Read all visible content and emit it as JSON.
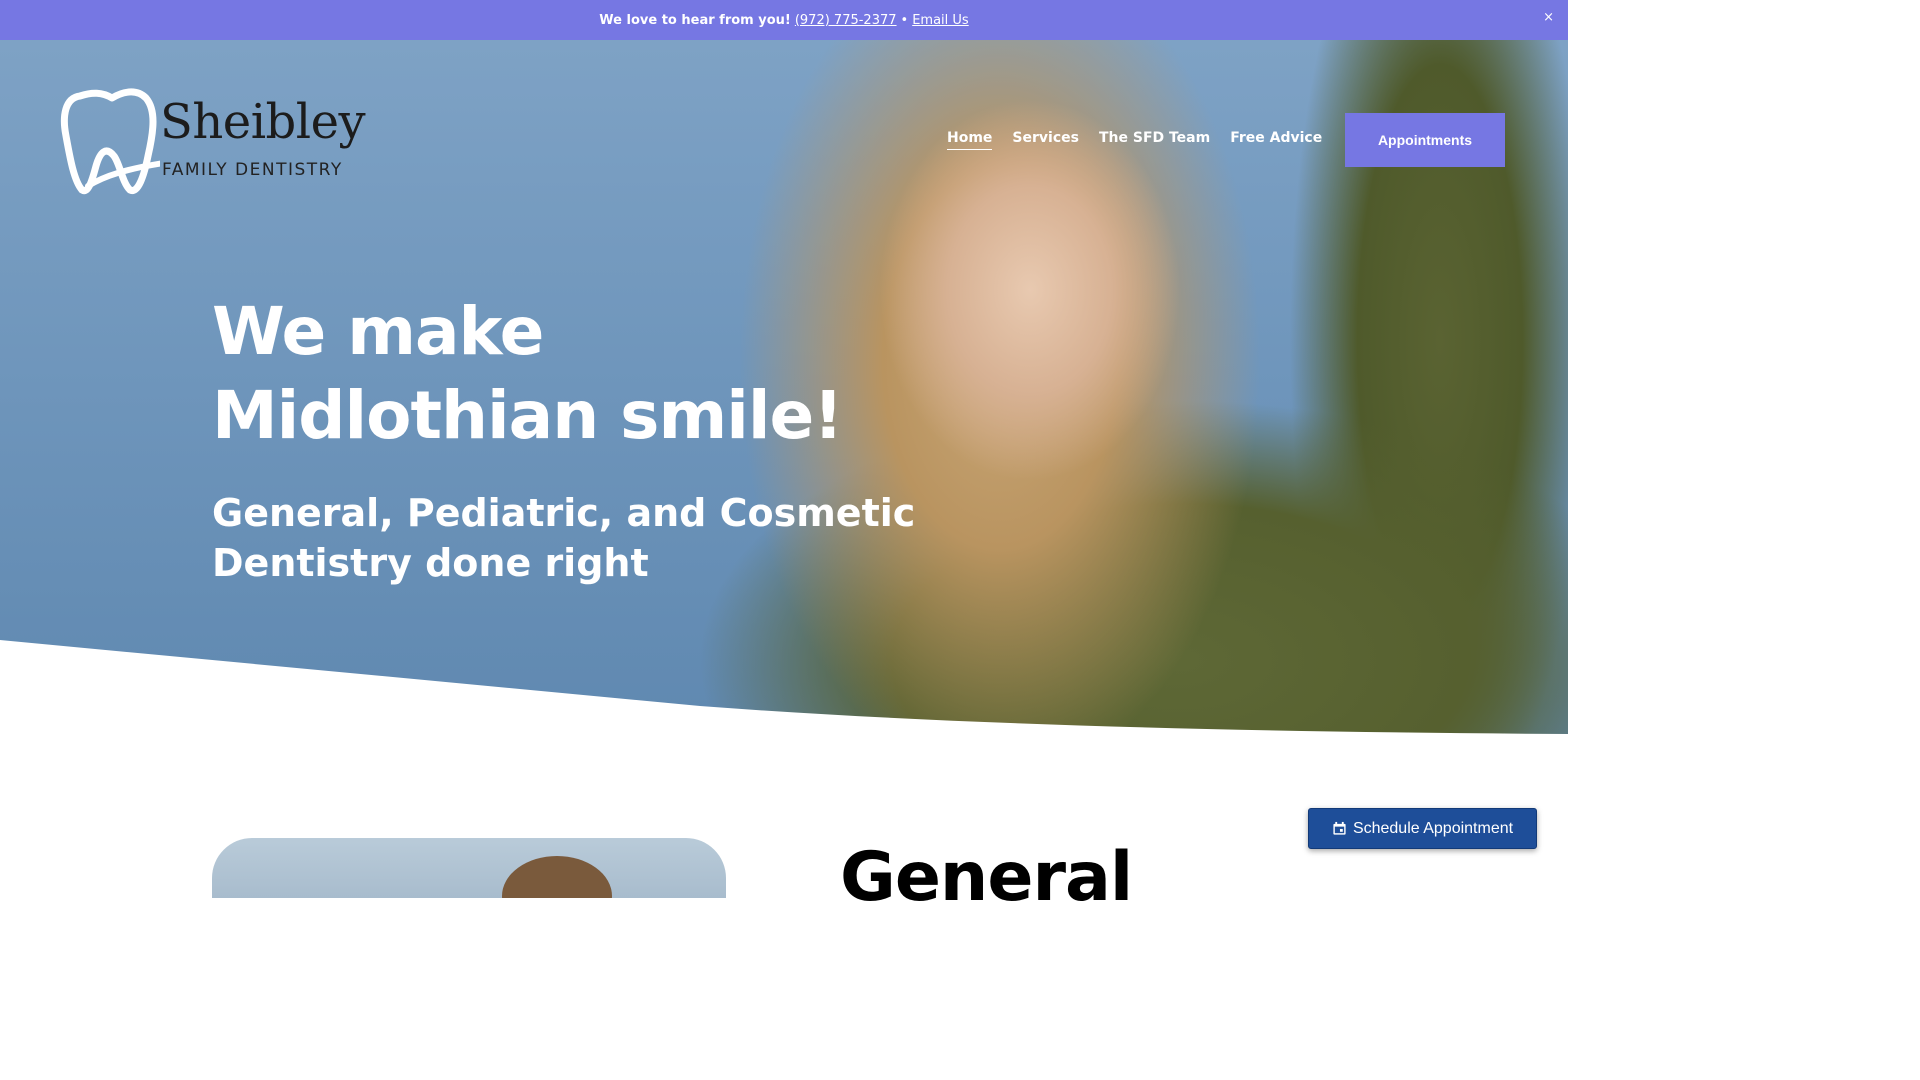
{
  "announcement": {
    "lead": "We love to hear from you!",
    "phone": "(972) 775-2377",
    "separator": "•",
    "email_link": "Email Us",
    "close": "×"
  },
  "logo": {
    "brand": "Sheibley",
    "subtitle": "FAMILY DENTISTRY"
  },
  "nav": {
    "items": [
      {
        "label": "Home",
        "active": true
      },
      {
        "label": "Services"
      },
      {
        "label": "The SFD Team"
      },
      {
        "label": "Free Advice"
      }
    ],
    "cta": "Appointments"
  },
  "hero": {
    "headline_line1": "We make",
    "headline_line2": "Midlothian smile!",
    "subheadline": "General, Pediatric, and Cosmetic Dentistry done right"
  },
  "section": {
    "heading": "General"
  },
  "widget": {
    "schedule_label": "Schedule Appointment",
    "icon": "calendar-icon"
  },
  "colors": {
    "accent": "#7677e3",
    "schedule_button": "#1e4e99"
  }
}
